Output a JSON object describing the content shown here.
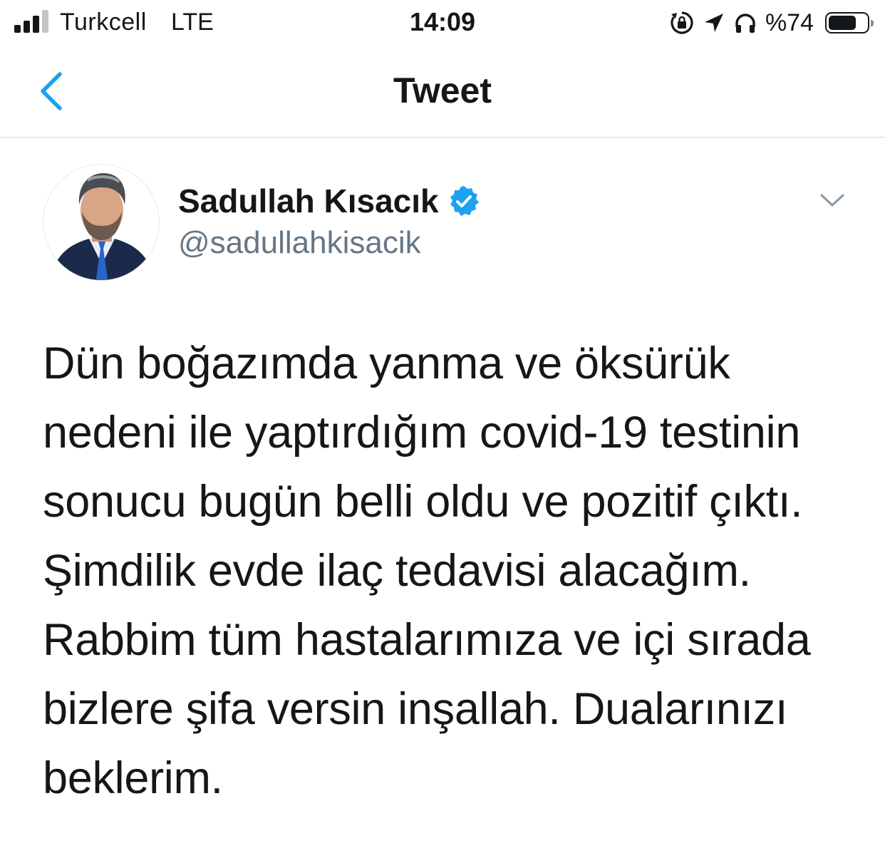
{
  "status_bar": {
    "carrier": "Turkcell",
    "network": "LTE",
    "time": "14:09",
    "battery_percent_label": "%74",
    "battery_level": 0.74,
    "signal_bars_active": 3,
    "signal_bars_total": 4,
    "icons": [
      "screen-rotation-lock-icon",
      "location-arrow-icon",
      "headphones-icon"
    ]
  },
  "nav": {
    "title": "Tweet",
    "back_icon": "chevron-left-icon"
  },
  "tweet": {
    "author": {
      "display_name": "Sadullah Kısacık",
      "handle": "@sadullahkisacik",
      "verified": true
    },
    "text_lines": [
      "Dün boğazımda yanma ve öksürük",
      "nedeni ile yaptırdığım covid-19 testinin",
      "sonucu bugün belli oldu ve pozitif çıktı.",
      "Şimdilik evde ilaç tedavisi alacağım.",
      "Rabbim tüm hastalarımıza ve içi sırada",
      "bizlere şifa versin inşallah. Dualarınızı",
      "beklerim."
    ]
  },
  "colors": {
    "accent": "#1da1f2",
    "text_primary": "#14171a",
    "text_secondary": "#657786",
    "divider": "#cfd5da",
    "chevron_gray": "#8899a6"
  }
}
